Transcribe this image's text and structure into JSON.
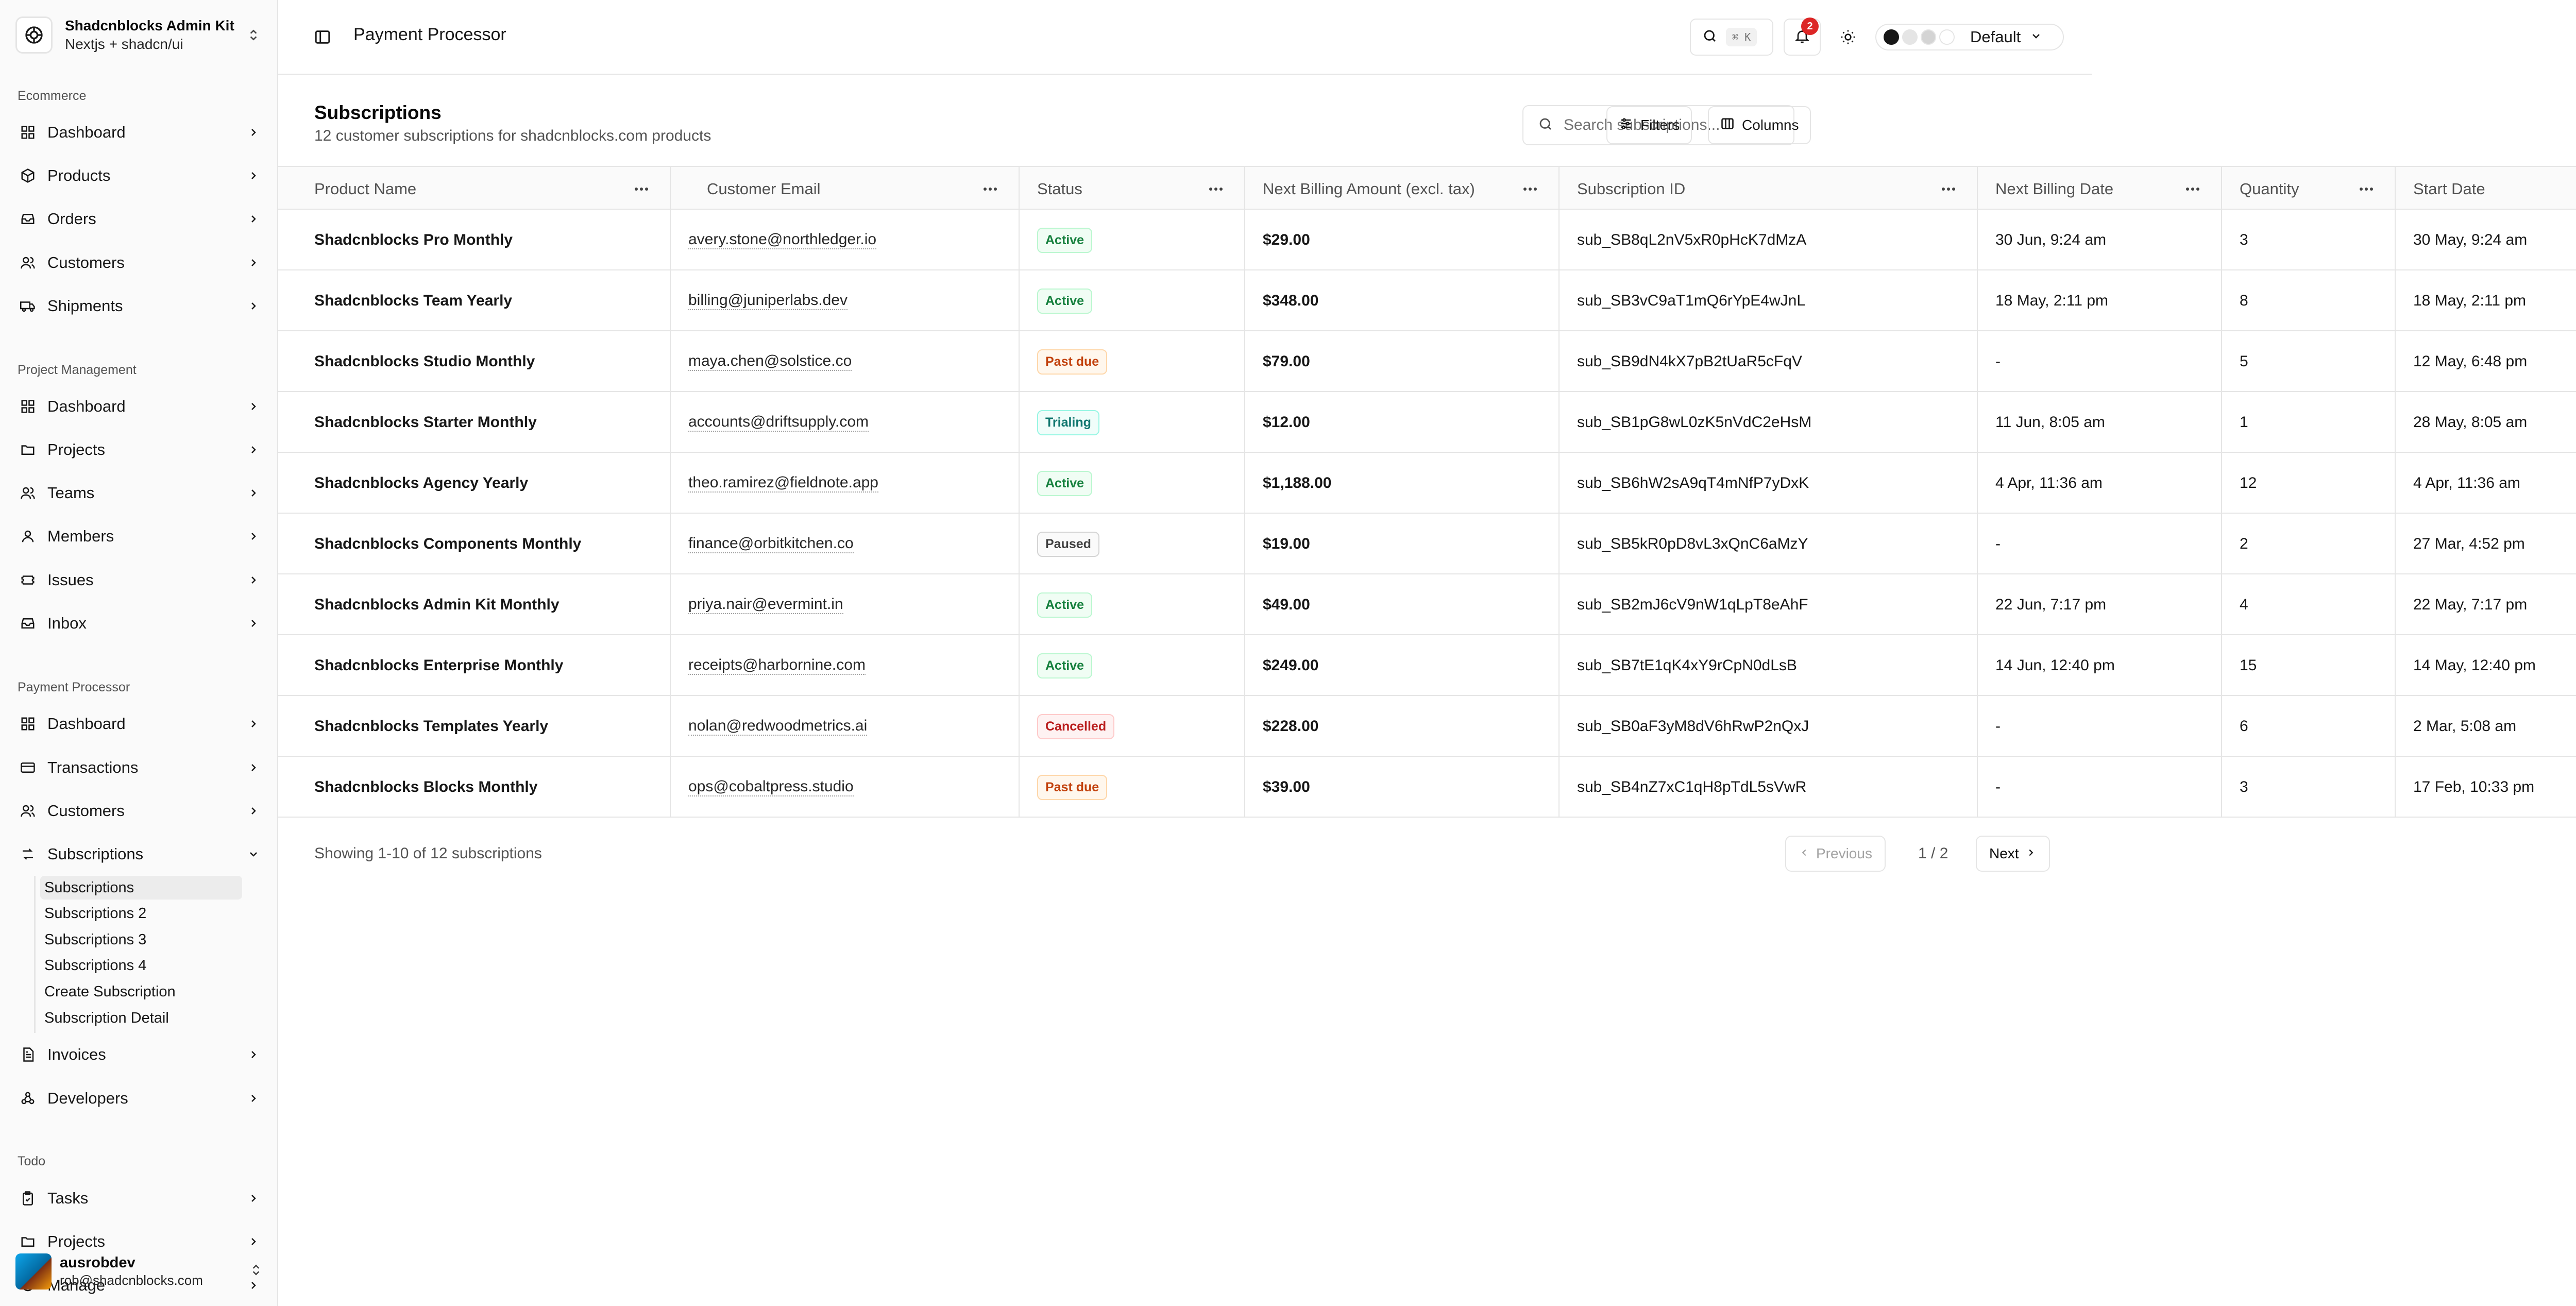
{
  "brand": {
    "title": "Shadcnblocks Admin Kit",
    "subtitle": "Nextjs + shadcn/ui"
  },
  "sidebar": {
    "groups": [
      {
        "label": "Ecommerce",
        "items": [
          "Dashboard",
          "Products",
          "Orders",
          "Customers",
          "Shipments"
        ]
      },
      {
        "label": "Project Management",
        "items": [
          "Dashboard",
          "Projects",
          "Teams",
          "Members",
          "Issues",
          "Inbox"
        ]
      },
      {
        "label": "Payment Processor",
        "items": [
          "Dashboard",
          "Transactions",
          "Customers",
          "Subscriptions",
          "Invoices",
          "Developers"
        ]
      },
      {
        "label": "Todo",
        "items": [
          "Tasks",
          "Projects",
          "Manage"
        ]
      }
    ],
    "subscription_sub_items": [
      "Subscriptions",
      "Subscriptions 2",
      "Subscriptions 3",
      "Subscriptions 4",
      "Create Subscription",
      "Subscription Detail"
    ]
  },
  "user": {
    "name": "ausrobdev",
    "email": "rob@shadcnblocks.com"
  },
  "topbar": {
    "title": "Payment Processor",
    "search_kbd": "⌘ K",
    "notification_count": "2",
    "palette_label": "Default",
    "palette_colors": [
      "#171717",
      "#e5e5e5",
      "#d4d4d4",
      "#ffffff"
    ]
  },
  "page": {
    "title": "Subscriptions",
    "subtitle": "12 customer subscriptions for shadcnblocks.com products",
    "search_placeholder": "Search subscriptions...",
    "filters_label": "Filters",
    "columns_label": "Columns"
  },
  "table": {
    "columns": [
      "Product Name",
      "Customer Email",
      "Status",
      "Next Billing Amount (excl. tax)",
      "Subscription ID",
      "Next Billing Date",
      "Quantity",
      "Start Date"
    ],
    "rows": [
      [
        "Shadcnblocks Pro Monthly",
        "avery.stone@northledger.io",
        "Active",
        "$29.00",
        "sub_SB8qL2nV5xR0pHcK7dMzA",
        "30 Jun, 9:24 am",
        "3",
        "30 May, 9:24 am"
      ],
      [
        "Shadcnblocks Team Yearly",
        "billing@juniperlabs.dev",
        "Active",
        "$348.00",
        "sub_SB3vC9aT1mQ6rYpE4wJnL",
        "18 May, 2:11 pm",
        "8",
        "18 May, 2:11 pm"
      ],
      [
        "Shadcnblocks Studio Monthly",
        "maya.chen@solstice.co",
        "Past due",
        "$79.00",
        "sub_SB9dN4kX7pB2tUaR5cFqV",
        "-",
        "5",
        "12 May, 6:48 pm"
      ],
      [
        "Shadcnblocks Starter Monthly",
        "accounts@driftsupply.com",
        "Trialing",
        "$12.00",
        "sub_SB1pG8wL0zK5nVdC2eHsM",
        "11 Jun, 8:05 am",
        "1",
        "28 May, 8:05 am"
      ],
      [
        "Shadcnblocks Agency Yearly",
        "theo.ramirez@fieldnote.app",
        "Active",
        "$1,188.00",
        "sub_SB6hW2sA9qT4mNfP7yDxK",
        "4 Apr, 11:36 am",
        "12",
        "4 Apr, 11:36 am"
      ],
      [
        "Shadcnblocks Components Monthly",
        "finance@orbitkitchen.co",
        "Paused",
        "$19.00",
        "sub_SB5kR0pD8vL3xQnC6aMzY",
        "-",
        "2",
        "27 Mar, 4:52 pm"
      ],
      [
        "Shadcnblocks Admin Kit Monthly",
        "priya.nair@evermint.in",
        "Active",
        "$49.00",
        "sub_SB2mJ6cV9nW1qLpT8eAhF",
        "22 Jun, 7:17 pm",
        "4",
        "22 May, 7:17 pm"
      ],
      [
        "Shadcnblocks Enterprise Monthly",
        "receipts@harbornine.com",
        "Active",
        "$249.00",
        "sub_SB7tE1qK4xY9rCpN0dLsB",
        "14 Jun, 12:40 pm",
        "15",
        "14 May, 12:40 pm"
      ],
      [
        "Shadcnblocks Templates Yearly",
        "nolan@redwoodmetrics.ai",
        "Cancelled",
        "$228.00",
        "sub_SB0aF3yM8dV6hRwP2nQxJ",
        "-",
        "6",
        "2 Mar, 5:08 am"
      ],
      [
        "Shadcnblocks Blocks Monthly",
        "ops@cobaltpress.studio",
        "Past due",
        "$39.00",
        "sub_SB4nZ7xC1qH8pTdL5sVwR",
        "-",
        "3",
        "17 Feb, 10:33 pm"
      ]
    ]
  },
  "status_colors": {
    "Active": {
      "fg": "#15803d",
      "bg": "#f0fdf4",
      "border": "#bbf7d0"
    },
    "Trialing": {
      "fg": "#0f766e",
      "bg": "#f0fdfa",
      "border": "#99f6e4"
    },
    "Past due": {
      "fg": "#c2410c",
      "bg": "#fff7ed",
      "border": "#fed7aa"
    },
    "Paused": {
      "fg": "#404040",
      "bg": "#fafafa",
      "border": "#d4d4d4"
    },
    "Cancelled": {
      "fg": "#b91c1c",
      "bg": "#fef2f2",
      "border": "#fecaca"
    }
  },
  "pagination": {
    "showing": "Showing 1-10 of 12 subscriptions",
    "previous": "Previous",
    "indicator": "1 / 2",
    "next": "Next"
  }
}
